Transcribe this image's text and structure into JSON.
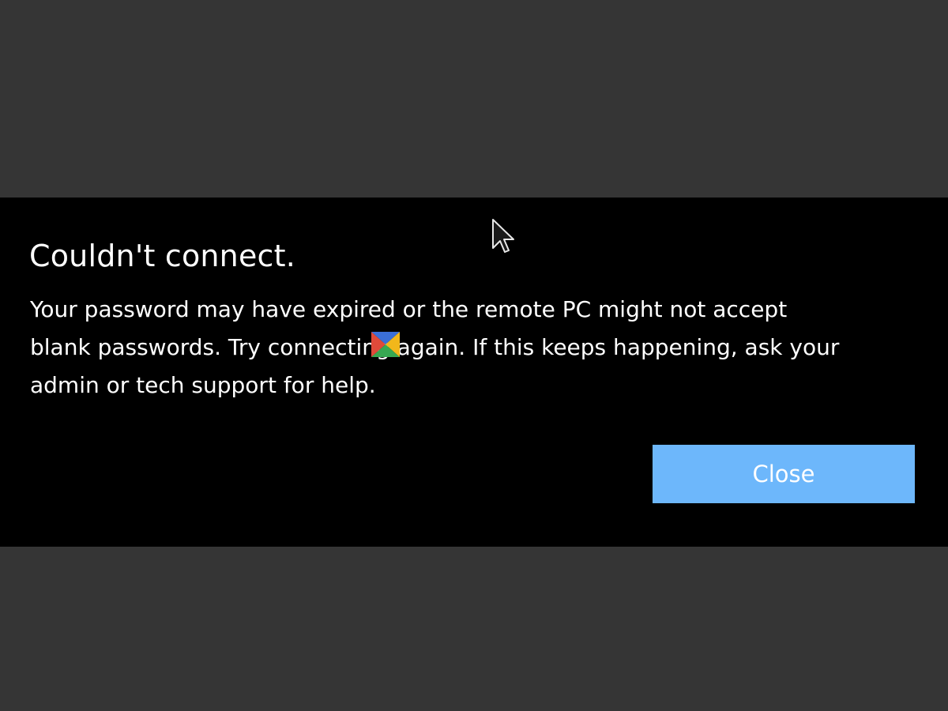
{
  "dialog": {
    "title": "Couldn't connect.",
    "message_lines": [
      "Your password may have expired or the remote PC might not accept",
      "blank passwords. Try connecting again. If this keeps happening, ask your",
      "admin or tech support for help."
    ],
    "close_label": "Close"
  },
  "colors": {
    "backdrop": "#353535",
    "dialog_background": "#000000",
    "text": "#ffffff",
    "button": "#6db7fb"
  },
  "icons": {
    "cursor": "mouse-pointer-icon",
    "watermark": "watermark-logo-icon"
  }
}
